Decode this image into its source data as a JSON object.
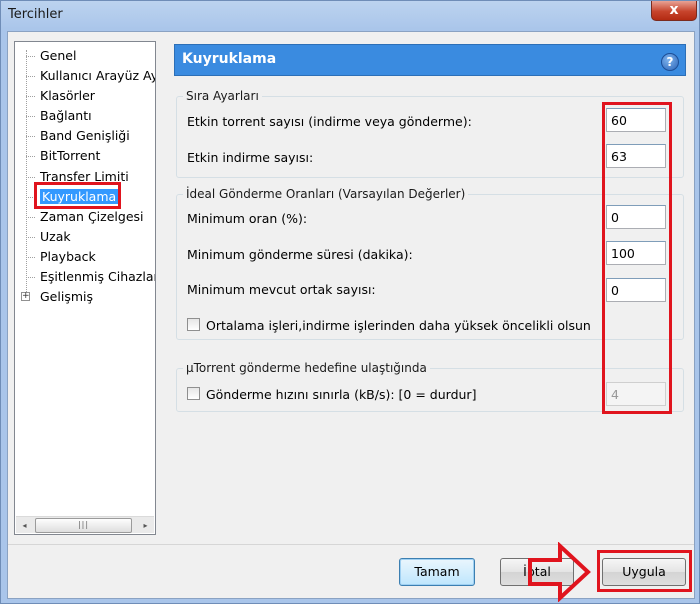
{
  "window": {
    "title": "Tercihler",
    "close_glyph": "x"
  },
  "tree": {
    "items": [
      {
        "label": "Genel"
      },
      {
        "label": "Kullanıcı Arayüz Ay"
      },
      {
        "label": "Klasörler"
      },
      {
        "label": "Bağlantı"
      },
      {
        "label": "Band Genişliği"
      },
      {
        "label": "BitTorrent"
      },
      {
        "label": "Transfer Limiti"
      },
      {
        "label": "Kuyruklama"
      },
      {
        "label": "Zaman Çizelgesi"
      },
      {
        "label": "Uzak"
      },
      {
        "label": "Playback"
      },
      {
        "label": "Eşitlenmiş Cihazlar"
      },
      {
        "label": "Gelişmiş",
        "expander": "+"
      }
    ],
    "selected": "Kuyruklama",
    "scrollbar": {
      "left_arrow": "◂",
      "right_arrow": "▸",
      "grip": "|||"
    }
  },
  "panel": {
    "title": "Kuyruklama",
    "help_glyph": "?",
    "queue_group": {
      "title": "Sıra Ayarları",
      "active_torrents_label": "Etkin torrent sayısı (indirme veya gönderme):",
      "active_torrents_value": "60",
      "active_downloads_label": "Etkin indirme sayısı:",
      "active_downloads_value": "63"
    },
    "seed_group": {
      "title": "İdeal Gönderme Oranları (Varsayılan Değerler)",
      "min_ratio_label": "Minimum oran (%):",
      "min_ratio_value": "0",
      "min_seed_time_label": "Minimum gönderme süresi (dakika):",
      "min_seed_time_value": "100",
      "min_peers_label": "Minimum mevcut ortak sayısı:",
      "min_peers_value": "0",
      "prioritize_label": "Ortalama işleri,indirme işlerinden daha yüksek öncelikli olsun"
    },
    "goal_group": {
      "title": "µTorrent gönderme hedefine ulaştığında",
      "limit_label": "Gönderme hızını sınırla (kB/s): [0 = durdur]",
      "limit_value": "4"
    }
  },
  "buttons": {
    "ok": "Tamam",
    "cancel": "İptal",
    "apply": "Uygula"
  },
  "colors": {
    "annotation_red": "#e0141e",
    "header_blue": "#3a8be0"
  }
}
